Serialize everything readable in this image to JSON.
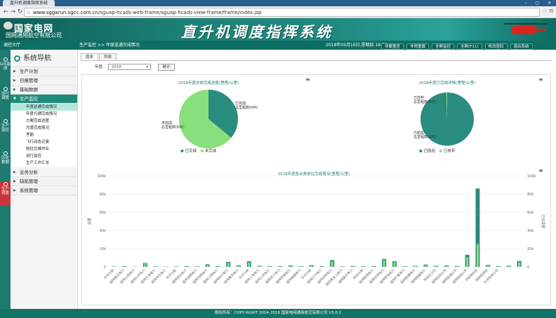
{
  "browser": {
    "tab_title": "直升机调度指挥系统",
    "window_buttons": "– ▢ ✕",
    "url_host": "www.sggarun.sgcc.com.cn",
    "url_path": "/sguap-hcads-web-frame/sguap-hcads-view-frame/frame/index.jsp"
  },
  "banner": {
    "logo_cn": "国家电网",
    "logo_sub": "国网通用航空有限公司",
    "system_title": "直升机调度指挥系统"
  },
  "topnav": {
    "label": "调控大厅",
    "breadcrumb": "生产监控 >> 年度巡通完成情况",
    "datetime": "2018年05月10日,星期四 18:36",
    "buttons": [
      "非要重查",
      "非常重载",
      "全屏监控",
      "全屏(F11)",
      "修改密码",
      "退出系统"
    ]
  },
  "rail": {
    "items": [
      "GIS监测",
      "运行调度",
      "生产监控",
      "历史数据",
      "生产调度"
    ]
  },
  "sidebar": {
    "header": "系统导航",
    "groups": [
      {
        "label": "生产计划"
      },
      {
        "label": "日报管理"
      },
      {
        "label": "基础数据"
      },
      {
        "label": "生产监控"
      }
    ],
    "subitems": [
      "年度巡通完成情况",
      "年度巧通完成情况",
      "方案完成进度",
      "月度完成情况",
      "考勤",
      "飞行动态记录",
      "航拉位维作业",
      "运行监控",
      "生产工作汇总"
    ],
    "more_groups": [
      "业务分析",
      "缺陷管理",
      "系统管理"
    ]
  },
  "main": {
    "tabs": [
      "图表",
      "列表"
    ],
    "filter_label": "年度:",
    "filter_value": "2018",
    "stat_button": "统计",
    "hamburger": "≡"
  },
  "colors": {
    "done": "#2a8c7f",
    "undone": "#88e07c",
    "header_green": "#1f8b7d"
  },
  "footer": {
    "text": "版权所有：COPY RIGHT 2014-2018 国家电网通用航空有限公司 V3.0.1"
  },
  "chart_data": [
    {
      "type": "pie",
      "title": "2018年度总体完成进度(里程/公里)",
      "labels": [
        "已完成",
        "未完成"
      ],
      "values": [
        36,
        64
      ],
      "annotations": {
        "done_label": "已完成:",
        "done_total": "总里程数(KM)：",
        "undone_label": "未完成:",
        "undone_total": "总里程数(KM)："
      }
    },
    {
      "type": "pie",
      "title": "2018年度已完成详情(里程/公里)",
      "labels": [
        "已航巡",
        "已放弃"
      ],
      "values": [
        99.5,
        0.5
      ],
      "annotations": {
        "done_label": "已航巡:",
        "done_total": "总里程数(KM)：",
        "abandon_label": "已放弃:",
        "abandon_total": "总里程数(KM)："
      }
    },
    {
      "type": "bar",
      "title": "2018年度各出责单位完成情况(里程/公里)",
      "ylabel": "总量",
      "y2label": "已完成量",
      "yticks": [
        "0",
        "20k",
        "40k",
        "60k",
        "80k",
        "100k"
      ],
      "ylim": [
        0,
        100000
      ],
      "categories": [
        "华北分部",
        "国网冀北电力",
        "国网山西电力",
        "国网山东电力",
        "国网天津电力",
        "国网河北电力",
        "华中分部",
        "国网湖北电力",
        "国网湖南电力",
        "国网河南电力",
        "国网江西电力",
        "国网四川电力",
        "国网重庆电力",
        "华东分部",
        "国网上海电力",
        "国网江苏电力",
        "国网浙江电力",
        "国网安徽电力",
        "国网福建电力",
        "东北分部",
        "国网辽宁电力",
        "国网吉林电力",
        "国网黑龙江电力",
        "国网蒙东电力",
        "西北分部",
        "国网陕西电力",
        "国网甘肃电力",
        "国网青海电力",
        "国网宁夏电力",
        "国网新疆电力",
        "国网西藏电力",
        "特高压公司",
        "国网运检公司",
        "国网信通公司",
        "国网营销公司",
        "中国电科院",
        "国网经研院",
        "北京检修公司"
      ],
      "series": [
        {
          "name": "总量",
          "values": [
            500,
            800,
            300,
            4200,
            600,
            300,
            500,
            900,
            600,
            2800,
            900,
            5400,
            1700,
            6200,
            1100,
            700,
            900,
            1600,
            700,
            1900,
            700,
            7400,
            600,
            1000,
            700,
            900,
            8700,
            6100,
            700,
            1100,
            2500,
            1200,
            1500,
            1000,
            13300,
            86000,
            2100,
            800,
            1300,
            6400
          ]
        },
        {
          "name": "已完成量",
          "values": [
            300,
            400,
            200,
            3500,
            400,
            200,
            300,
            500,
            400,
            2000,
            600,
            4500,
            1200,
            5000,
            800,
            500,
            600,
            1200,
            500,
            1500,
            500,
            6000,
            400,
            700,
            500,
            600,
            7400,
            5200,
            500,
            800,
            2000,
            900,
            1100,
            700,
            10500,
            25000,
            1600,
            600,
            900,
            5000
          ]
        }
      ]
    }
  ]
}
